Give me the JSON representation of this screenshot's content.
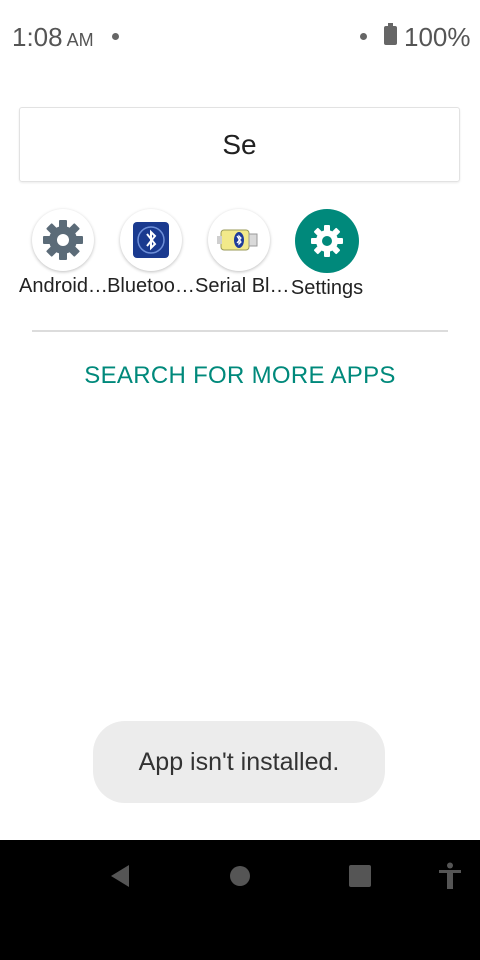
{
  "status_bar": {
    "time": "1:08",
    "ampm": "AM",
    "battery": "100%"
  },
  "search": {
    "query": "Se"
  },
  "apps": [
    {
      "label": "Android…",
      "icon": "gear-icon"
    },
    {
      "label": "Bluetoo…",
      "icon": "bluetooth-icon"
    },
    {
      "label": "Serial Bl…",
      "icon": "serial-bluetooth-icon"
    },
    {
      "label": "Settings",
      "icon": "settings-icon"
    }
  ],
  "more_apps_label": "SEARCH FOR MORE APPS",
  "toast": {
    "message": "App isn't installed."
  },
  "colors": {
    "accent": "#00897B",
    "toast_bg": "#ececec",
    "nav_bg": "#000000"
  }
}
